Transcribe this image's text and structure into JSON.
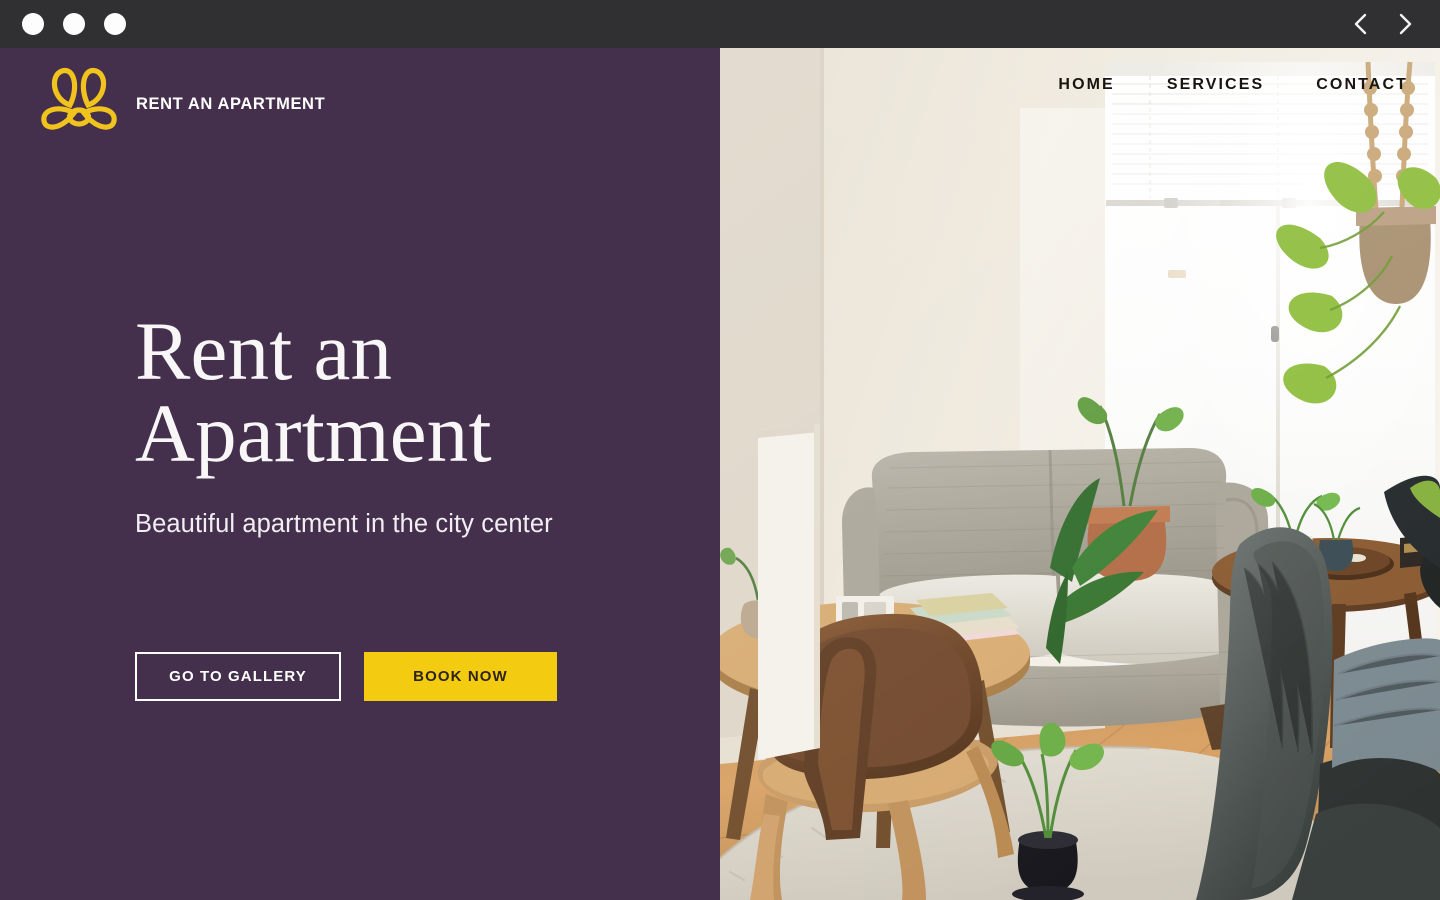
{
  "window": {
    "titlebar": {
      "dots": [
        "window-dot-1",
        "window-dot-2",
        "window-dot-3"
      ],
      "prev_icon": "chevron-left-icon",
      "next_icon": "chevron-right-icon"
    }
  },
  "brand": {
    "logo_icon": "interlocking-loops-logo",
    "name": "RENT AN APARTMENT"
  },
  "nav": {
    "items": [
      {
        "label": "HOME"
      },
      {
        "label": "SERVICES"
      },
      {
        "label": "CONTACT"
      }
    ]
  },
  "hero": {
    "title_line1": "Rent an",
    "title_line2": "Apartment",
    "subtitle": "Beautiful apartment in the city center",
    "buttons": [
      {
        "label": "GO TO GALLERY",
        "style": "outline"
      },
      {
        "label": "BOOK NOW",
        "style": "solid"
      }
    ]
  },
  "photo": {
    "alt": "Sunlit living room with grey fabric sofa, wooden coffee table, plywood chair, potted plants, office chair and large window with blinds"
  },
  "colors": {
    "purple": "#44304C",
    "yellow": "#F3CB11",
    "titlebar": "#303032",
    "text_light": "#FFFFFF",
    "nav_text": "#18140F"
  }
}
